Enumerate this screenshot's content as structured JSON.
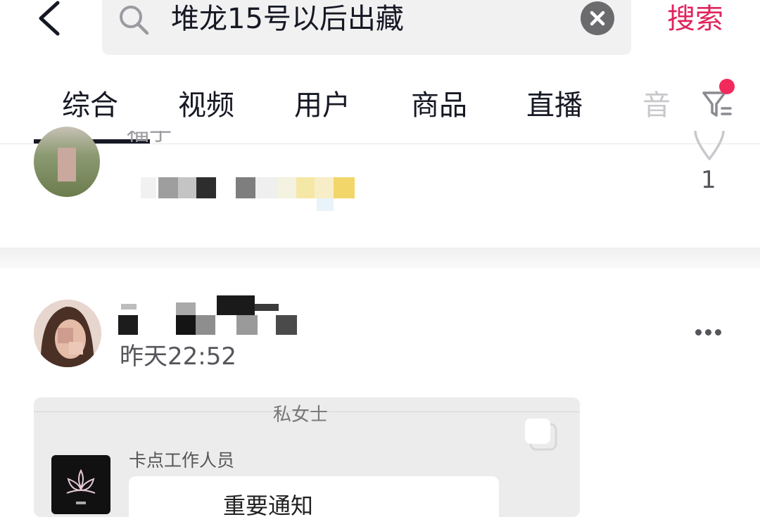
{
  "header": {
    "search_query": "堆龙15号以后出藏",
    "search_button_label": "搜索",
    "icons": [
      "back-arrow-icon",
      "search-icon",
      "clear-icon"
    ]
  },
  "tabs": [
    {
      "label": "综合",
      "active": true
    },
    {
      "label": "视频",
      "active": false
    },
    {
      "label": "用户",
      "active": false
    },
    {
      "label": "商品",
      "active": false
    },
    {
      "label": "直播",
      "active": false
    },
    {
      "label": "音",
      "active": false
    }
  ],
  "filter": {
    "icon": "filter-icon",
    "has_badge": true,
    "badge_color": "#f2295b"
  },
  "posts": [
    {
      "name_partial": "福子",
      "like_count": "1",
      "like_icon": "heart-icon"
    },
    {
      "time": "昨天22:52",
      "more_icon": "more-dots-icon",
      "shared_image": {
        "title_partial": "私女士",
        "sender": "卡点工作人员",
        "message": "重要通知"
      }
    }
  ],
  "colors": {
    "accent": "#e0245e",
    "text": "#161823",
    "muted": "#55555b"
  }
}
